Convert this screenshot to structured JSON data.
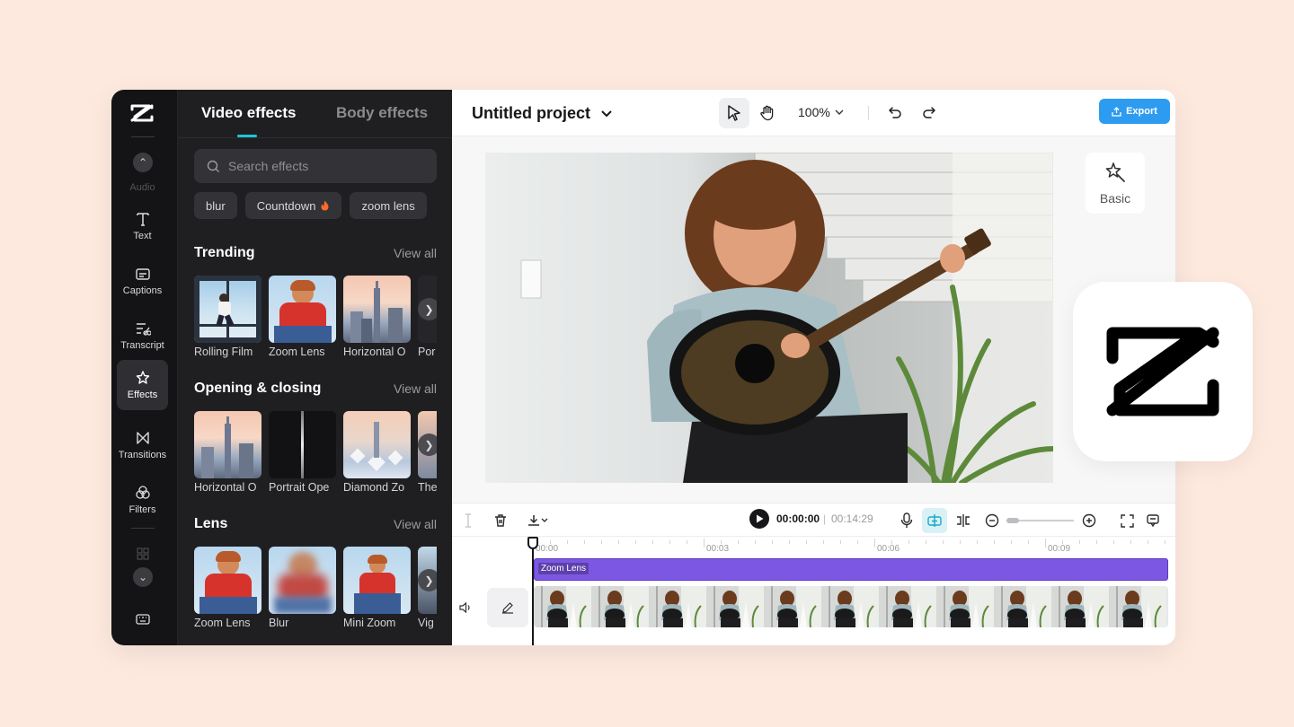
{
  "rail": {
    "items": [
      {
        "label": "Audio",
        "icon": "audio-icon"
      },
      {
        "label": "Text",
        "icon": "text-icon"
      },
      {
        "label": "Captions",
        "icon": "captions-icon"
      },
      {
        "label": "Transcript",
        "icon": "transcript-icon"
      },
      {
        "label": "Effects",
        "icon": "effects-icon",
        "active": true
      },
      {
        "label": "Transitions",
        "icon": "transitions-icon"
      },
      {
        "label": "Filters",
        "icon": "filters-icon"
      }
    ]
  },
  "panel": {
    "tabs": [
      {
        "label": "Video effects",
        "active": true
      },
      {
        "label": "Body effects",
        "active": false
      }
    ],
    "search_placeholder": "Search effects",
    "chips": [
      "blur",
      "Countdown",
      "zoom lens"
    ],
    "sections": [
      {
        "title": "Trending",
        "view_all": "View all",
        "items": [
          "Rolling Film",
          "Zoom Lens",
          "Horizontal O",
          "Por"
        ]
      },
      {
        "title": "Opening & closing",
        "view_all": "View all",
        "items": [
          "Horizontal O",
          "Portrait Ope",
          "Diamond Zo",
          "The"
        ]
      },
      {
        "title": "Lens",
        "view_all": "View all",
        "items": [
          "Zoom Lens",
          "Blur",
          "Mini Zoom",
          "Vig"
        ]
      }
    ]
  },
  "topbar": {
    "project_title": "Untitled project",
    "zoom_level": "100%",
    "export_label": "Export"
  },
  "inspector": {
    "basic_label": "Basic"
  },
  "timeline": {
    "current_time": "00:00:00",
    "separator": "|",
    "total_time": "00:14:29",
    "ruler_labels": [
      "00:00",
      "00:03",
      "00:06",
      "00:09"
    ],
    "effect_clip_label": "Zoom Lens"
  },
  "colors": {
    "accent": "#22c4d8",
    "export": "#2d9cf0",
    "effect_track": "#7c57e3",
    "background": "#fde9de"
  }
}
